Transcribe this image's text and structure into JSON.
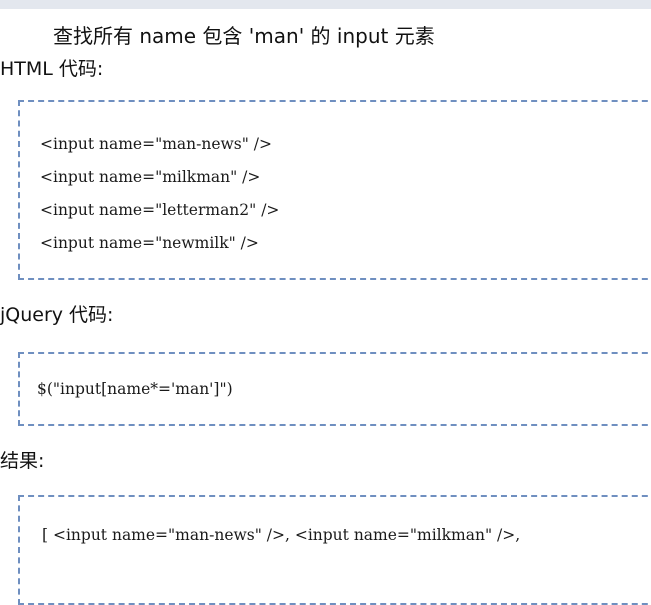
{
  "description": "查找所有 name 包含 'man' 的 input 元素",
  "sections": {
    "html": {
      "label": "HTML 代码:",
      "code_lines": [
        "<input name=\"man-news\" />",
        "<input name=\"milkman\" />",
        "<input name=\"letterman2\" />",
        "<input name=\"newmilk\" />"
      ]
    },
    "jquery": {
      "label": "jQuery 代码:",
      "code": "$(\"input[name*='man']\")"
    },
    "result": {
      "label": "结果:",
      "code": "[ <input name=\"man-news\" />, <input name=\"milkman\" />,"
    }
  },
  "colors": {
    "border": "#6f8fc0",
    "top_band": "#e3e7ee"
  }
}
